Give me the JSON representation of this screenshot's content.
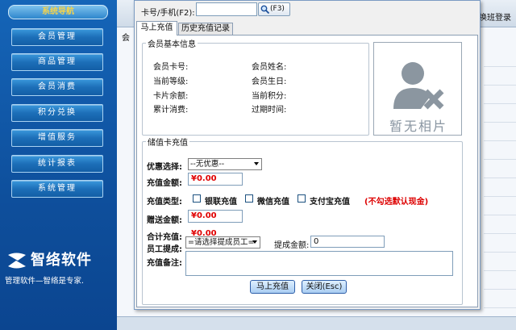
{
  "nav": {
    "title": "系统导航",
    "items": [
      "会员管理",
      "商品管理",
      "会员消费",
      "积分兑换",
      "增值服务",
      "统计报表",
      "系统管理"
    ],
    "logo_text": "智络软件",
    "slogan": "管理软件—智络是专家."
  },
  "background": {
    "shift_label": "换班登录",
    "tab_fragment": "会"
  },
  "dialog": {
    "card_label": "卡号/手机(F2):",
    "card_value": "",
    "search_label": "(F3)",
    "tabs": [
      "马上充值",
      "历史充值记录"
    ],
    "basic_info": {
      "legend": "会员基本信息",
      "left": [
        "会员卡号:",
        "当前等级:",
        "卡片余额:",
        "累计消费:"
      ],
      "right": [
        "会员姓名:",
        "会员生日:",
        "当前积分:",
        "过期时间:"
      ]
    },
    "photo_text": "暂无相片",
    "recharge": {
      "legend": "储值卡充值",
      "discount_label": "优惠选择:",
      "discount_value": "--无优惠--",
      "amount_label": "充值金额:",
      "amount_value": "¥0.00",
      "type_label": "充值类型:",
      "types": [
        "银联充值",
        "微信充值",
        "支付宝充值"
      ],
      "type_note": "(不勾选默认现金)",
      "gift_label": "赠送金额:",
      "gift_value": "¥0.00",
      "total_label": "合计充值:",
      "total_value": "¥0.00",
      "staff_label": "员工提成:",
      "staff_value": "=请选择提成员工=",
      "commission_label": "提成金额:",
      "commission_value": "0",
      "remark_label": "充值备注:",
      "remark_value": ""
    },
    "buttons": {
      "submit": "马上充值",
      "close": "关闭(Esc)"
    }
  },
  "colors": {
    "nav_bg": "#1565b8",
    "accent_red": "#e00000",
    "title_yellow": "#f5d34a"
  }
}
